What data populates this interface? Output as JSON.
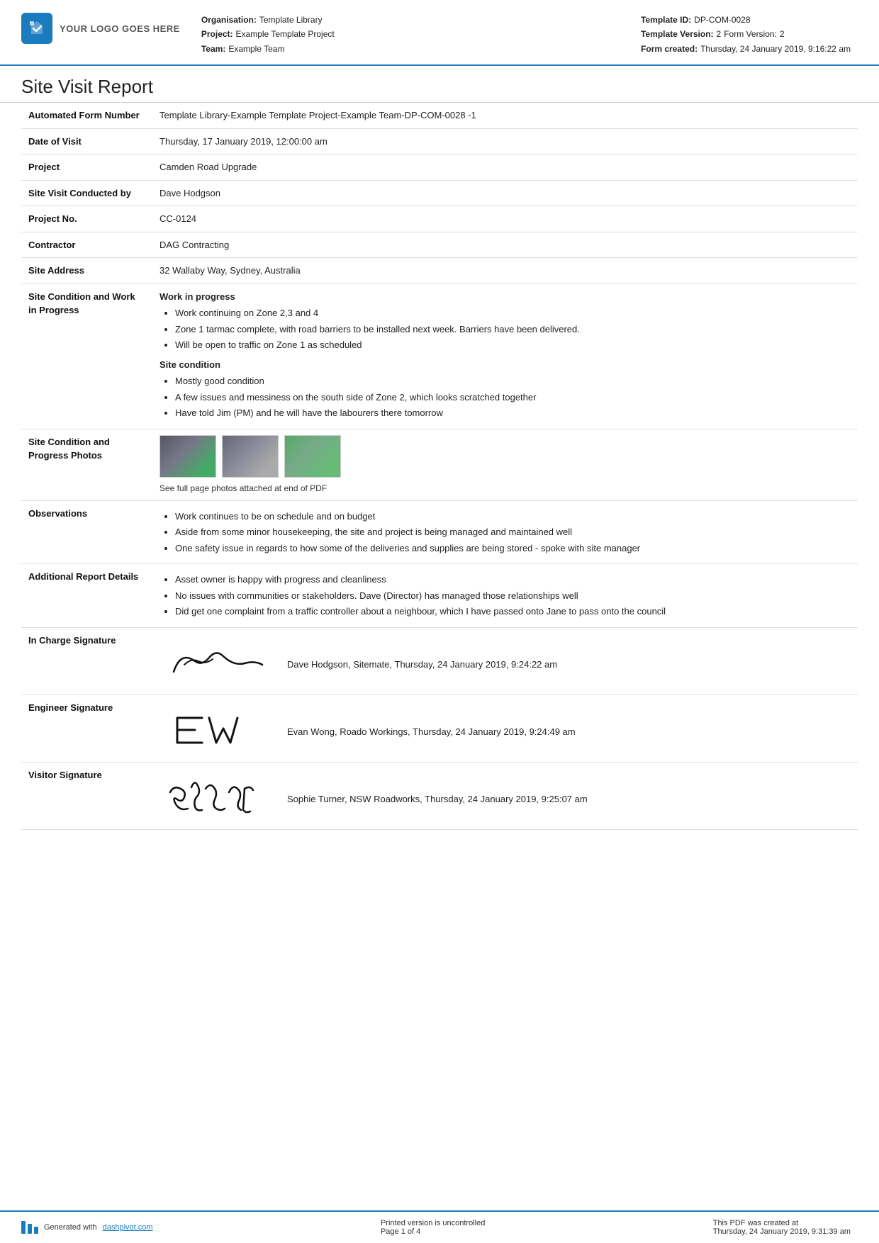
{
  "header": {
    "logo_text": "YOUR LOGO GOES HERE",
    "organisation_label": "Organisation:",
    "organisation_value": "Template Library",
    "project_label": "Project:",
    "project_value": "Example Template Project",
    "team_label": "Team:",
    "team_value": "Example Team",
    "template_id_label": "Template ID:",
    "template_id_value": "DP-COM-0028",
    "template_version_label": "Template Version:",
    "template_version_value": "2",
    "form_version_label": "Form Version:",
    "form_version_value": "2",
    "form_created_label": "Form created:",
    "form_created_value": "Thursday, 24 January 2019, 9:16:22 am"
  },
  "report": {
    "title": "Site Visit Report"
  },
  "fields": {
    "form_number_label": "Automated Form Number",
    "form_number_value": "Template Library-Example Template Project-Example Team-DP-COM-0028   -1",
    "date_of_visit_label": "Date of Visit",
    "date_of_visit_value": "Thursday, 17 January 2019, 12:00:00 am",
    "project_label": "Project",
    "project_value": "Camden Road Upgrade",
    "site_visit_label": "Site Visit Conducted by",
    "site_visit_value": "Dave Hodgson",
    "project_no_label": "Project No.",
    "project_no_value": "CC-0124",
    "contractor_label": "Contractor",
    "contractor_value": "DAG Contracting",
    "site_address_label": "Site Address",
    "site_address_value": "32 Wallaby Way, Sydney, Australia",
    "site_condition_label": "Site Condition and Work in Progress",
    "site_condition_heading1": "Work in progress",
    "site_condition_bullets1": [
      "Work continuing on Zone 2,3 and 4",
      "Zone 1 tarmac complete, with road barriers to be installed next week. Barriers have been delivered.",
      "Will be open to traffic on Zone 1 as scheduled"
    ],
    "site_condition_heading2": "Site condition",
    "site_condition_bullets2": [
      "Mostly good condition",
      "A few issues and messiness on the south side of Zone 2, which looks scratched together",
      "Have told Jim (PM) and he will have the labourers there tomorrow"
    ],
    "photos_label": "Site Condition and Progress Photos",
    "photos_caption": "See full page photos attached at end of PDF",
    "observations_label": "Observations",
    "observations_bullets": [
      "Work continues to be on schedule and on budget",
      "Aside from some minor housekeeping, the site and project is being managed and maintained well",
      "One safety issue in regards to how some of the deliveries and supplies are being stored - spoke with site manager"
    ],
    "additional_label": "Additional Report Details",
    "additional_bullets": [
      "Asset owner is happy with progress and cleanliness",
      "No issues with communities or stakeholders. Dave (Director) has managed those relationships well",
      "Did get one complaint from a traffic controller about a neighbour, which I have passed onto Jane to pass onto the council"
    ],
    "in_charge_label": "In Charge Signature",
    "in_charge_sig_text": "Dave Hodgson, Sitemate, Thursday, 24 January 2019, 9:24:22 am",
    "engineer_label": "Engineer Signature",
    "engineer_sig_text": "Evan Wong, Roado Workings, Thursday, 24 January 2019, 9:24:49 am",
    "visitor_label": "Visitor Signature",
    "visitor_sig_text": "Sophie Turner, NSW Roadworks, Thursday, 24 January 2019, 9:25:07 am"
  },
  "footer": {
    "generated_label": "Generated with",
    "site_link": "dashpivot.com",
    "uncontrolled_text": "Printed version is uncontrolled",
    "page_info": "Page 1 of 4",
    "pdf_created_label": "This PDF was created at",
    "pdf_created_value": "Thursday, 24 January 2019, 9:31:39 am"
  }
}
